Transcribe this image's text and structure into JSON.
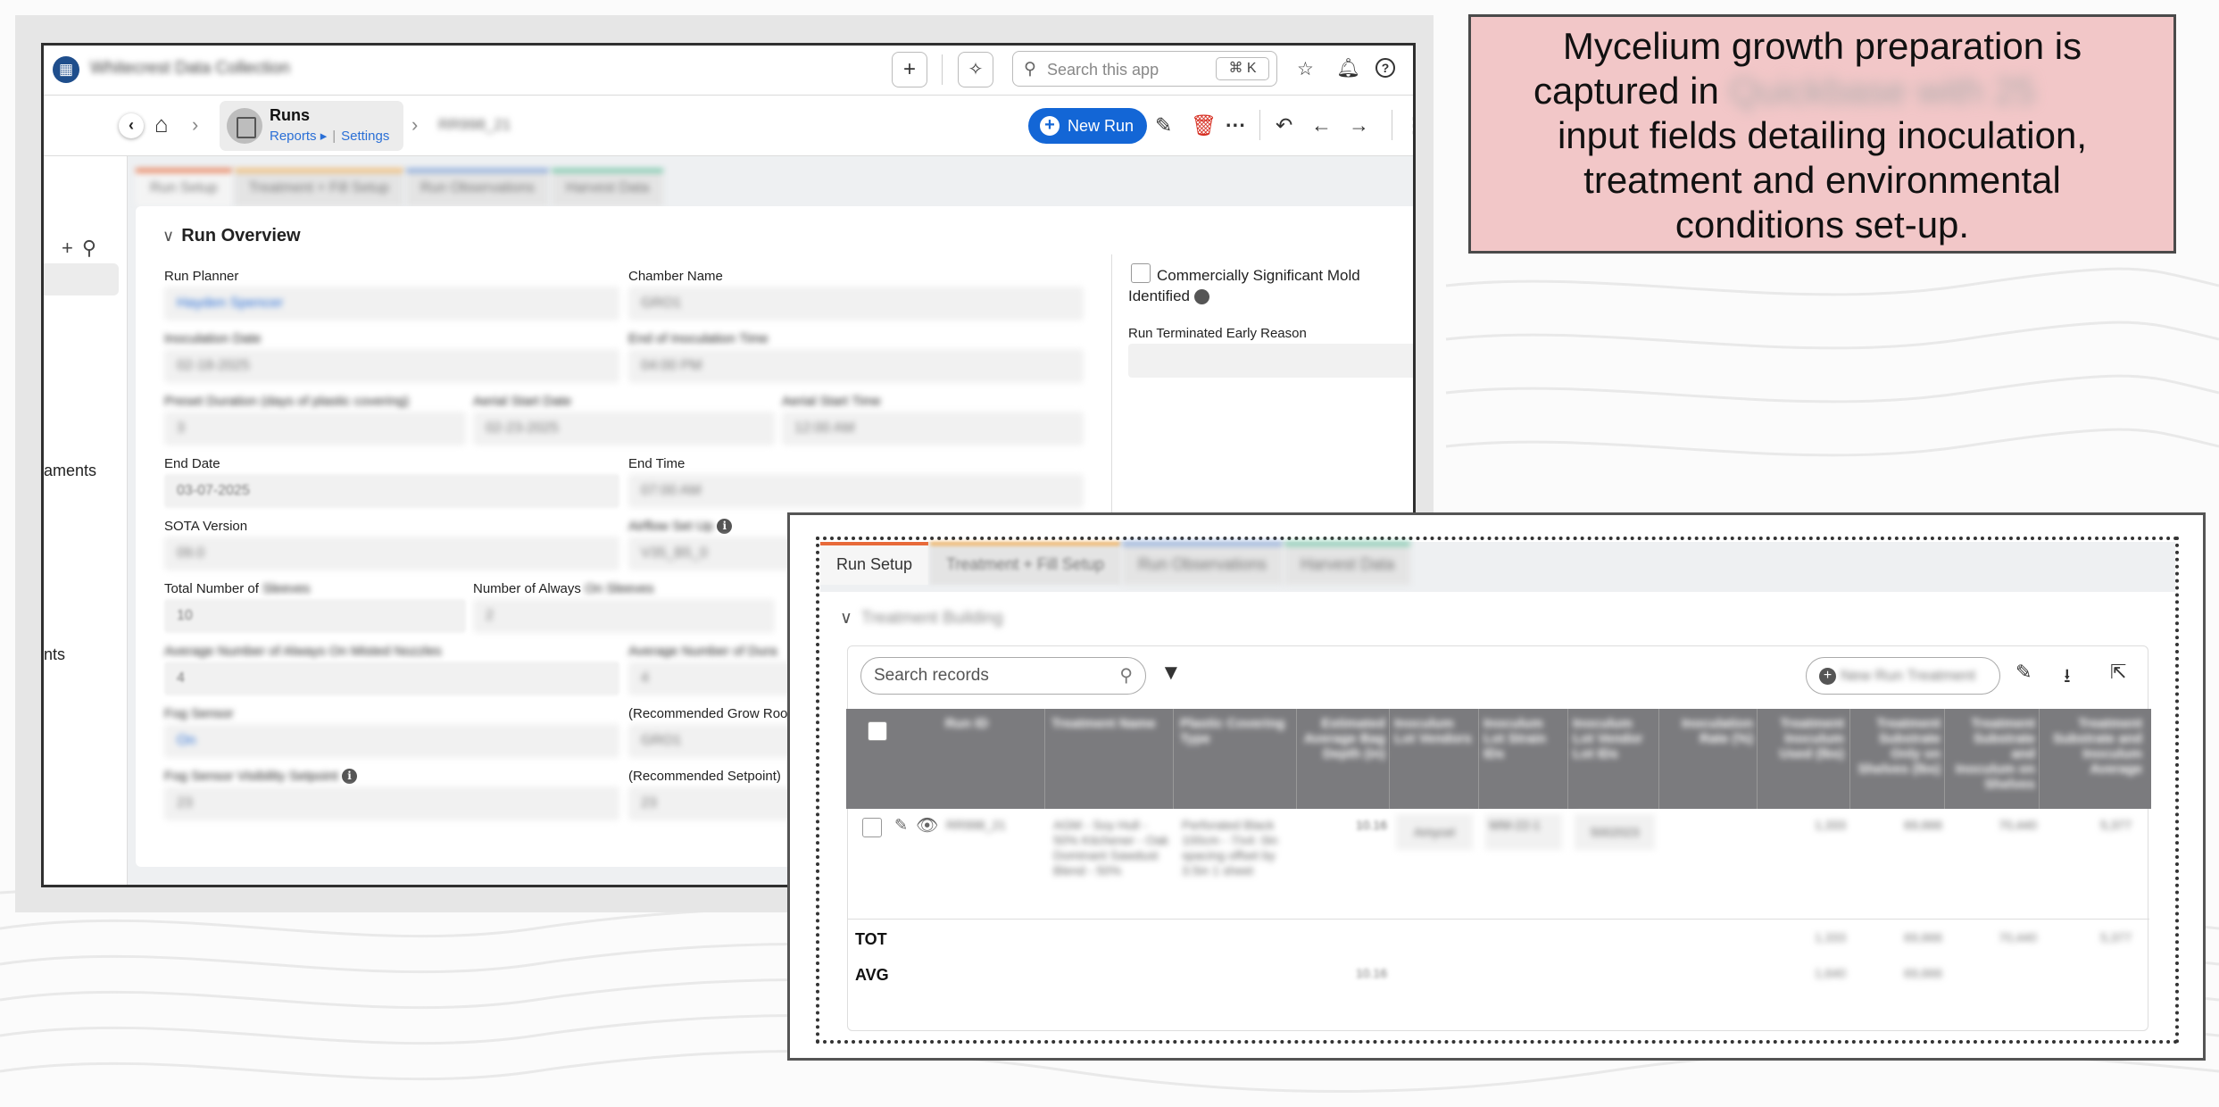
{
  "app": {
    "title": "Whitecrest Data Collection"
  },
  "topbar": {
    "add_icon": "plus-icon",
    "ai_icon": "sparkle-icon",
    "search_placeholder": "Search this app",
    "shortcut": "⌘ K"
  },
  "breadcrumb": {
    "table_name": "Runs",
    "reports_link": "Reports ▸",
    "settings_link": "Settings",
    "record": "RR998_21"
  },
  "toolbar": {
    "new_run_label": "New Run"
  },
  "sidebar": {
    "items": [
      "aments",
      "nts"
    ]
  },
  "tabs": [
    {
      "label": "Run Setup",
      "color": "#e86a3a"
    },
    {
      "label": "Treatment + Fill Setup",
      "color": "#f2b25c"
    },
    {
      "label": "Run Observations",
      "color": "#7b9fd8"
    },
    {
      "label": "Harvest Data",
      "color": "#66c3a0"
    }
  ],
  "run_overview": {
    "title": "Run Overview",
    "run_planner_label": "Run Planner",
    "run_planner_value": "Hayden Spencer",
    "chamber_name_label": "Chamber Name",
    "chamber_name_value": "GRO1",
    "inoculation_date_label": "Inoculation Date",
    "inoculation_date_value": "02-18-2025",
    "end_inoculation_time_label": "End of Inoculation Time",
    "end_inoculation_time_value": "04:00 PM",
    "preset_duration_label": "Preset Duration (days of plastic covering)",
    "preset_duration_value": "3",
    "aerial_start_date_label": "Aerial Start Date",
    "aerial_start_date_value": "02-23-2025",
    "aerial_start_time_label": "Aerial Start Time",
    "aerial_start_time_value": "12:00 AM",
    "end_date_label": "End Date",
    "end_date_value": "03-07-2025",
    "end_time_label": "End Time",
    "end_time_value": "07:00 AM",
    "sota_label": "SOTA Version",
    "sota_value": "09.0",
    "airflow_label": "Airflow Set Up",
    "airflow_value": "V35_B5_0",
    "total_number_label_a": "Total Number of",
    "total_number_label_b": "Sleeves",
    "total_number_value": "10",
    "always_on_label_a": "Number of Always",
    "always_on_label_b": "On Sleeves",
    "always_on_value": "2",
    "avg_sleeves_label": "Average Number of Always On Misted Nozzles",
    "avg_sleeves_value": "4",
    "avg_number_label": "Average Number of Dura",
    "avg_number_value": "4",
    "fog_sensor_label": "Fog Sensor",
    "fog_sensor_value": "On",
    "rec_grow_room_label": "(Recommended Grow Roo",
    "rec_grow_room_value": "GRO1",
    "fog_setpoint_label": "Fog Sensor Visibility Setpoint",
    "fog_setpoint_value": "23",
    "rec_setpoint_label": "(Recommended Setpoint)",
    "rec_setpoint_value": "23",
    "mold_label": "Commercially Significant Mold Identified",
    "terminated_label": "Run Terminated Early Reason"
  },
  "callout": {
    "line1": "Mycelium growth preparation is",
    "line2a": "captured in",
    "line2b": "Quickbase with 25",
    "line3": "input fields detailing inoculation,",
    "line4": "treatment and environmental",
    "line5": "conditions set-up."
  },
  "inset": {
    "tabs": [
      "Run Setup",
      "Treatment + Fill Setup",
      "Run Observations",
      "Harvest Data"
    ],
    "section_title": "Treatment Building",
    "search_placeholder": "Search records",
    "new_treatment_label": "New Run Treatment",
    "columns": [
      "Run ID",
      "Treatment Name",
      "Plastic Covering Type",
      "Estimated Average Bag Depth (in)",
      "Inoculum Lot Vendors",
      "Inoculum Lot Strain IDs",
      "Inoculum Lot Vendor Lot IDs",
      "Inoculation Rate (%)",
      "Treatment Inoculum Used (lbs)",
      "Treatment Substrate Only on Shelves (lbs)",
      "Treatment Substrate and Inoculum on Shelves",
      "Treatment Substrate and Inoculum Average"
    ],
    "row": {
      "run_id": "RR998_21",
      "treatment_name": "AGM - Soy Hull - 50% Kitchener - Oak Dominant Sawdust Blend - 50%",
      "plastic": "Perforated Black 100cm - 7/x4: 0in spacing offset by 3.5in 1 sheet",
      "bag_depth": "10.16",
      "vendor": "Amycel",
      "strain": "WM-22-1",
      "vendor_lot": "5002023",
      "inoc_used": "1,333",
      "sub_only": "69,666",
      "sub_inoc": "70,440",
      "avg": "5,377"
    },
    "tot_label": "TOT",
    "avg_label": "AVG",
    "tot": {
      "inoc_used": "1,333",
      "sub_only": "69,666",
      "sub_inoc": "70,440",
      "avg": "5,377"
    },
    "avg": {
      "bag_depth": "10.16",
      "inoc_used": "1,640",
      "sub_only": "69,666"
    }
  }
}
